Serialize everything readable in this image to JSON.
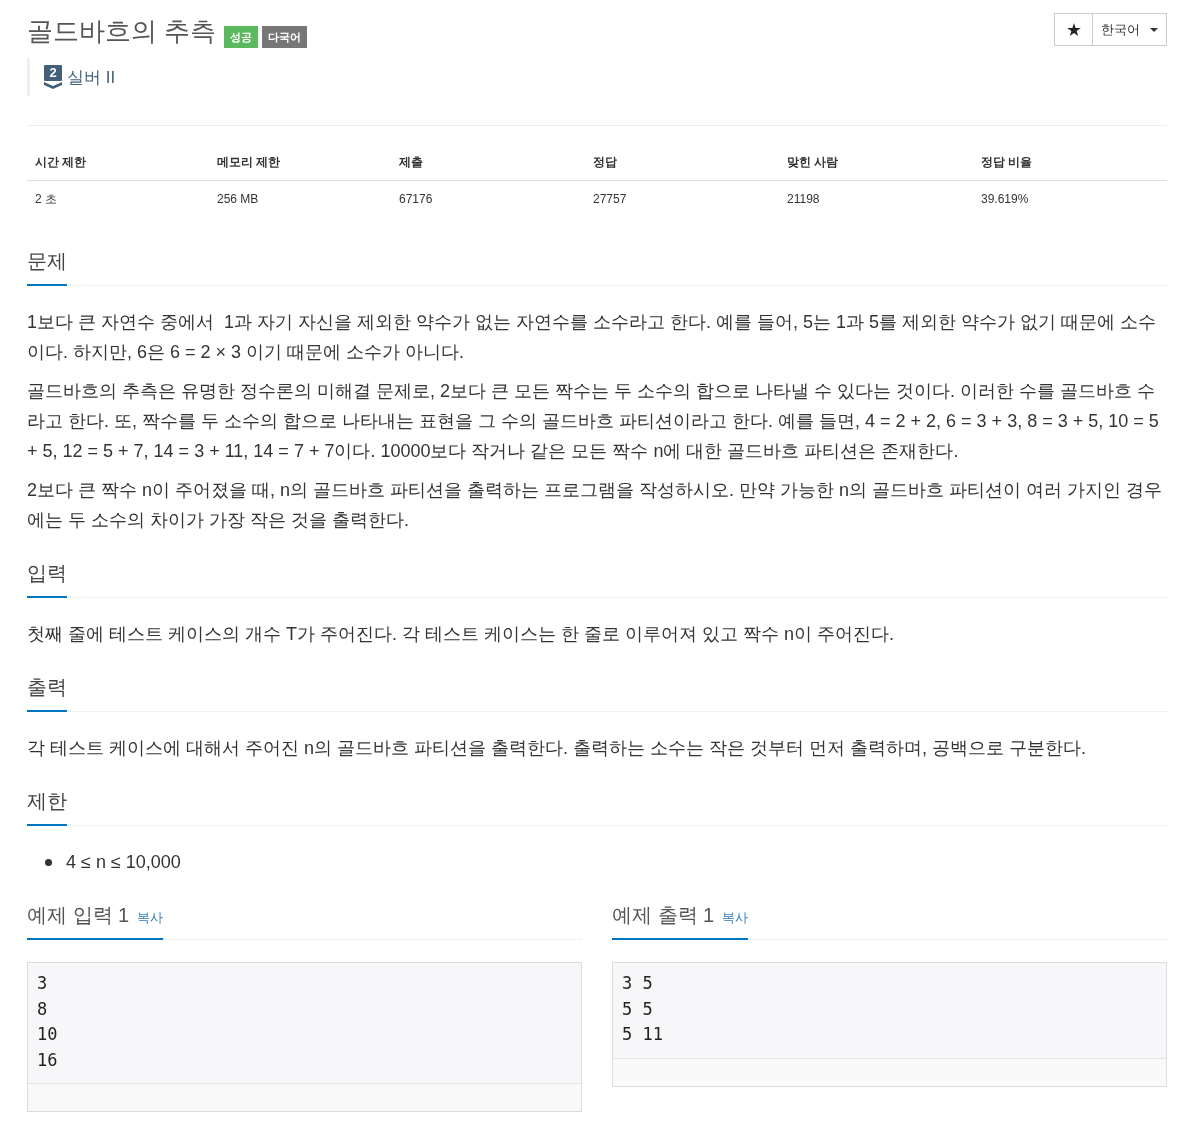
{
  "problem": {
    "title": "골드바흐의 추측",
    "badges": [
      {
        "label": "성공",
        "color": "#5cb85c"
      },
      {
        "label": "다국어",
        "color": "#777777"
      }
    ]
  },
  "toolbar": {
    "language": "한국어"
  },
  "tier": {
    "level_digit": "2",
    "name": "실버 II"
  },
  "stats": {
    "columns": [
      "시간 제한",
      "메모리 제한",
      "제출",
      "정답",
      "맞힌 사람",
      "정답 비율"
    ],
    "rows": [
      [
        "2 초",
        "256 MB",
        "67176",
        "27757",
        "21198",
        "39.619%"
      ]
    ]
  },
  "sections": [
    {
      "heading": "문제",
      "kind": "paragraphs",
      "paragraphs": [
        "1보다 큰 자연수 중에서  1과 자기 자신을 제외한 약수가 없는 자연수를 소수라고 한다. 예를 들어, 5는 1과 5를 제외한 약수가 없기 때문에 소수이다. 하지만, 6은 6 = 2 × 3 이기 때문에 소수가 아니다.",
        "골드바흐의 추측은 유명한 정수론의 미해결 문제로, 2보다 큰 모든 짝수는 두 소수의 합으로 나타낼 수 있다는 것이다. 이러한 수를 골드바흐 수라고 한다. 또, 짝수를 두 소수의 합으로 나타내는 표현을 그 수의 골드바흐 파티션이라고 한다. 예를 들면, 4 = 2 + 2, 6 = 3 + 3, 8 = 3 + 5, 10 = 5 + 5, 12 = 5 + 7, 14 = 3 + 11, 14 = 7 + 7이다. 10000보다 작거나 같은 모든 짝수 n에 대한 골드바흐 파티션은 존재한다.",
        "2보다 큰 짝수 n이 주어졌을 때, n의 골드바흐 파티션을 출력하는 프로그램을 작성하시오. 만약 가능한 n의 골드바흐 파티션이 여러 가지인 경우에는 두 소수의 차이가 가장 작은 것을 출력한다."
      ]
    },
    {
      "heading": "입력",
      "kind": "paragraphs",
      "paragraphs": [
        "첫째 줄에 테스트 케이스의 개수 T가 주어진다. 각 테스트 케이스는 한 줄로 이루어져 있고 짝수 n이 주어진다."
      ]
    },
    {
      "heading": "출력",
      "kind": "paragraphs",
      "paragraphs": [
        "각 테스트 케이스에 대해서 주어진 n의 골드바흐 파티션을 출력한다. 출력하는 소수는 작은 것부터 먼저 출력하며, 공백으로 구분한다."
      ]
    },
    {
      "heading": "제한",
      "kind": "bullets",
      "items": [
        "4 ≤ n ≤ 10,000"
      ]
    }
  ],
  "samples": [
    {
      "heading": "예제 입력 1",
      "copy_link": "복사",
      "content": "3\n8\n10\n16"
    },
    {
      "heading": "예제 출력 1",
      "copy_link": "복사",
      "content": "3 5\n5 5\n5 11"
    }
  ]
}
